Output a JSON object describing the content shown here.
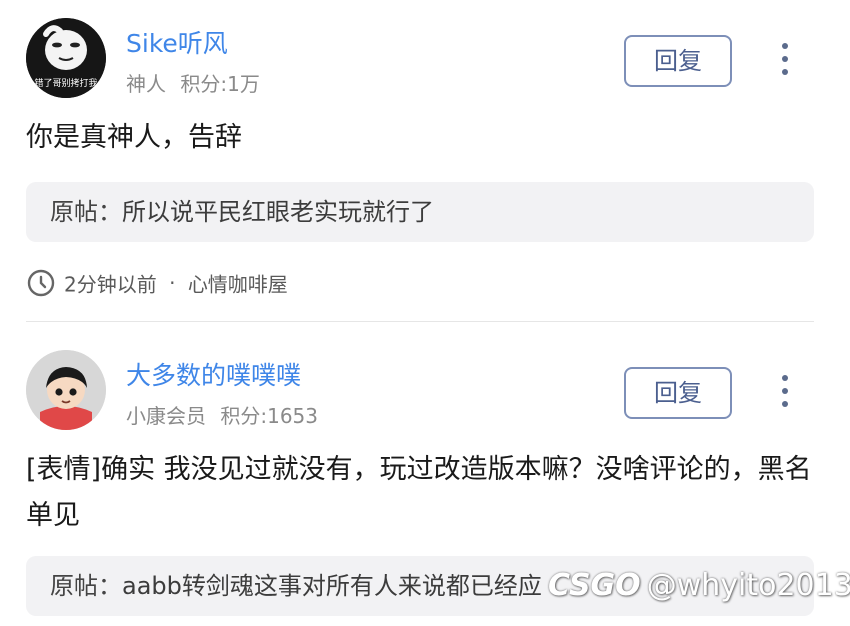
{
  "comments": [
    {
      "username": "Sike听风",
      "rank": "神人",
      "points": "积分:1万",
      "avatar_caption": "错了哥别拷打我",
      "reply_label": "回复",
      "body": "你是真神人，告辞",
      "quote_label": "原帖：",
      "quote_text": "所以说平民红眼老实玩就行了",
      "time": "2分钟以前",
      "separator": "·",
      "board": "心情咖啡屋"
    },
    {
      "username": "大多数的噗噗噗",
      "rank": "小康会员",
      "points": "积分:1653",
      "reply_label": "回复",
      "body": "[表情]确实  我没见过就没有，玩过改造版本嘛？没啥评论的，黑名单见",
      "quote_label": "原帖：",
      "quote_text": "aabb转剑魂这事对所有人来说都已经应"
    }
  ],
  "watermark": "@whyito2013",
  "watermark_logo": "CSGO",
  "colors": {
    "username": "#3f86e8",
    "meta": "#8a8a8a",
    "reply_border": "#7d8fb8",
    "quote_bg": "#f2f2f4"
  },
  "icons": [
    "clock-icon",
    "more-vertical-icon"
  ]
}
